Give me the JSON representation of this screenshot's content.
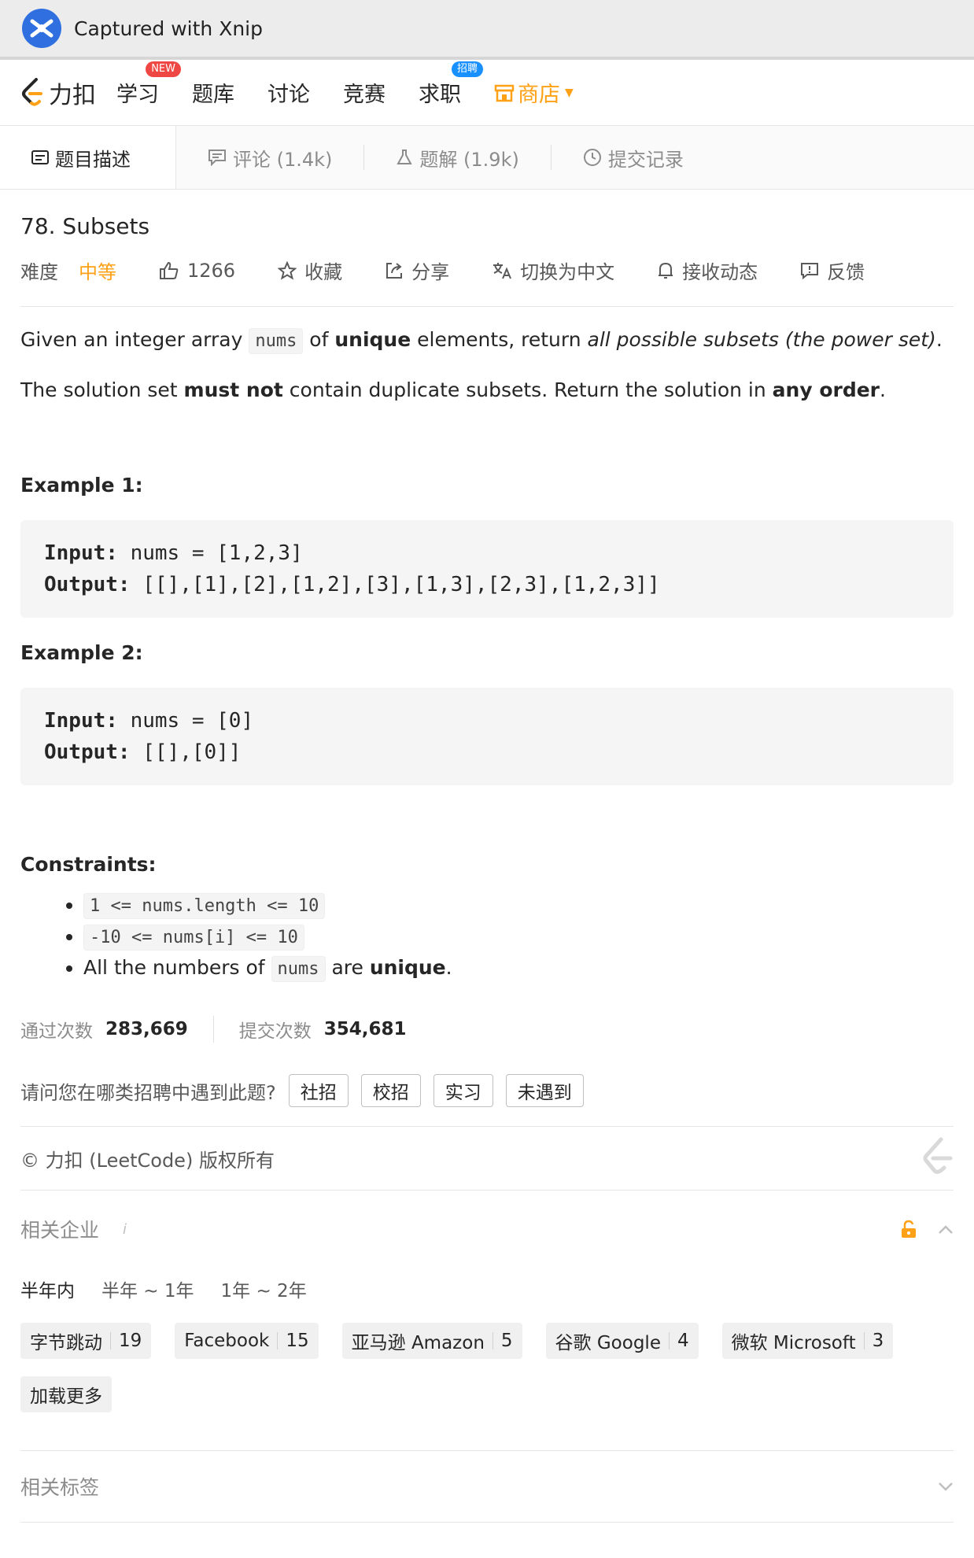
{
  "xnip": {
    "title": "Captured with Xnip"
  },
  "nav": {
    "brand": "力扣",
    "items": [
      {
        "label": "学习",
        "badge": "NEW"
      },
      {
        "label": "题库",
        "badge": ""
      },
      {
        "label": "讨论",
        "badge": ""
      },
      {
        "label": "竞赛",
        "badge": ""
      },
      {
        "label": "求职",
        "badge": "招聘"
      }
    ],
    "shop": "商店"
  },
  "tabs": [
    {
      "label": "题目描述"
    },
    {
      "label": "评论 (1.4k)"
    },
    {
      "label": "题解 (1.9k)"
    },
    {
      "label": "提交记录"
    }
  ],
  "problem": {
    "title": "78. Subsets",
    "difficulty_label": "难度",
    "difficulty": "中等",
    "likes": "1266",
    "actions": [
      "收藏",
      "分享",
      "切换为中文",
      "接收动态",
      "反馈"
    ],
    "desc1": {
      "a": "Given an integer array ",
      "code": "nums",
      "b": " of ",
      "bold": "unique",
      "c": " elements, return ",
      "italic": "all possible subsets (the power set)",
      "d": "."
    },
    "desc2": {
      "a": "The solution set ",
      "bold1": "must not",
      "b": " contain duplicate subsets. Return the solution in ",
      "bold2": "any order",
      "c": "."
    },
    "examples": [
      {
        "title": "Example 1:",
        "input_label": "Input:",
        "input": "nums = [1,2,3]",
        "output_label": "Output:",
        "output": "[[],[1],[2],[1,2],[3],[1,3],[2,3],[1,2,3]]"
      },
      {
        "title": "Example 2:",
        "input_label": "Input:",
        "input": "nums = [0]",
        "output_label": "Output:",
        "output": "[[],[0]]"
      }
    ],
    "constraints_title": "Constraints:",
    "constraints": {
      "c1": "1 <= nums.length <= 10",
      "c2": "-10 <= nums[i] <= 10",
      "c3a": "All the numbers of ",
      "c3code": "nums",
      "c3b": " are ",
      "c3bold": "unique",
      "c3c": "."
    }
  },
  "stats": {
    "accepted_label": "通过次数",
    "accepted": "283,669",
    "submitted_label": "提交次数",
    "submitted": "354,681"
  },
  "survey": {
    "question": "请问您在哪类招聘中遇到此题?",
    "options": [
      "社招",
      "校招",
      "实习",
      "未遇到"
    ]
  },
  "copyright": "© 力扣 (LeetCode) 版权所有",
  "companies": {
    "title": "相关企业",
    "info": "i",
    "periods": [
      "半年内",
      "半年 ~ 1年",
      "1年 ~ 2年"
    ],
    "list": [
      {
        "name": "字节跳动",
        "count": "19"
      },
      {
        "name": "Facebook",
        "count": "15"
      },
      {
        "name": "亚马逊 Amazon",
        "count": "5"
      },
      {
        "name": "谷歌 Google",
        "count": "4"
      },
      {
        "name": "微软 Microsoft",
        "count": "3"
      }
    ],
    "load_more": "加载更多"
  },
  "tags": {
    "title": "相关标签"
  },
  "colors": {
    "accent": "#ffa116",
    "new_badge": "#ef4743",
    "job_badge": "#1890ff"
  }
}
